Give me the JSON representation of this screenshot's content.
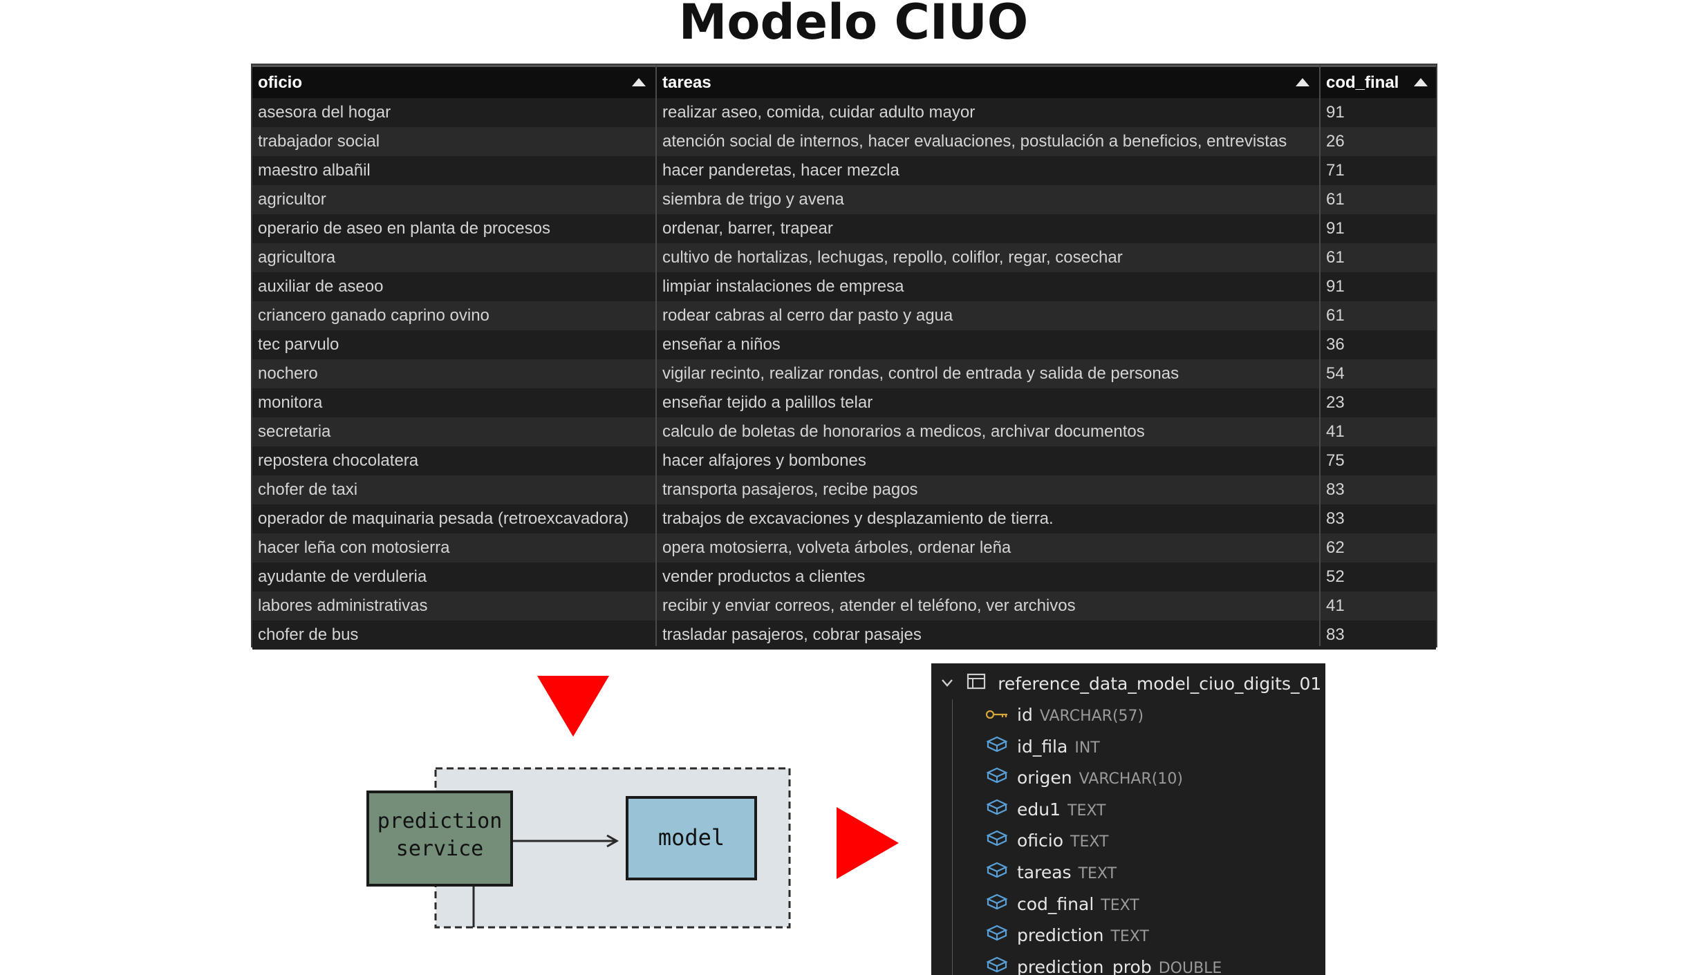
{
  "title": "Modelo CIUO",
  "table": {
    "columns": [
      "oficio",
      "tareas",
      "cod_final"
    ],
    "rows": [
      [
        "asesora del hogar",
        "realizar aseo, comida, cuidar adulto mayor",
        "91"
      ],
      [
        "trabajador social",
        "atención social de internos, hacer evaluaciones, postulación a beneficios, entrevistas",
        "26"
      ],
      [
        "maestro albañil",
        "hacer panderetas, hacer mezcla",
        "71"
      ],
      [
        "agricultor",
        "siembra de trigo y avena",
        "61"
      ],
      [
        "operario de aseo en planta de procesos",
        "ordenar, barrer, trapear",
        "91"
      ],
      [
        "agricultora",
        "cultivo de hortalizas, lechugas, repollo, coliflor, regar, cosechar",
        "61"
      ],
      [
        "auxiliar de aseoo",
        "limpiar instalaciones de empresa",
        "91"
      ],
      [
        "criancero ganado caprino ovino",
        "rodear cabras al cerro dar pasto y agua",
        "61"
      ],
      [
        "tec parvulo",
        "enseñar a niños",
        "36"
      ],
      [
        "nochero",
        "vigilar recinto, realizar rondas, control de entrada y salida de personas",
        "54"
      ],
      [
        "monitora",
        "enseñar tejido a palillos telar",
        "23"
      ],
      [
        "secretaria",
        "calculo de boletas de honorarios a medicos, archivar documentos",
        "41"
      ],
      [
        "repostera chocolatera",
        "hacer alfajores y bombones",
        "75"
      ],
      [
        "chofer de taxi",
        "transporta pasajeros, recibe pagos",
        "83"
      ],
      [
        "operador de maquinaria pesada (retroexcavadora)",
        "trabajos de excavaciones y desplazamiento de tierra.",
        "83"
      ],
      [
        "hacer leña con motosierra",
        "opera motosierra, volveta árboles, ordenar leña",
        "62"
      ],
      [
        "ayudante de verduleria",
        "vender productos a clientes",
        "52"
      ],
      [
        "labores administrativas",
        "recibir y enviar correos, atender el teléfono, ver archivos",
        "41"
      ],
      [
        "chofer de bus",
        "trasladar pasajeros, cobrar pasajes",
        "83"
      ]
    ]
  },
  "diagram": {
    "service_label_line1": "prediction",
    "service_label_line2": "service",
    "model_label": "model"
  },
  "schema": {
    "table_name": "reference_data_model_ciuo_digits_01",
    "columns": [
      {
        "name": "id",
        "type": "VARCHAR(57)",
        "icon": "key-icon"
      },
      {
        "name": "id_fila",
        "type": "INT",
        "icon": "column-icon"
      },
      {
        "name": "origen",
        "type": "VARCHAR(10)",
        "icon": "column-icon"
      },
      {
        "name": "edu1",
        "type": "TEXT",
        "icon": "column-icon"
      },
      {
        "name": "oficio",
        "type": "TEXT",
        "icon": "column-icon"
      },
      {
        "name": "tareas",
        "type": "TEXT",
        "icon": "column-icon"
      },
      {
        "name": "cod_final",
        "type": "TEXT",
        "icon": "column-icon"
      },
      {
        "name": "prediction",
        "type": "TEXT",
        "icon": "column-icon"
      },
      {
        "name": "prediction_prob",
        "type": "DOUBLE",
        "icon": "column-icon"
      }
    ]
  },
  "colors": {
    "arrow": "#ff0000",
    "service_box": "#748e79",
    "model_box": "#98c3d6",
    "container": "#dde3e6",
    "key_icon": "#d7a63a",
    "column_icon": "#5aa0d8"
  }
}
